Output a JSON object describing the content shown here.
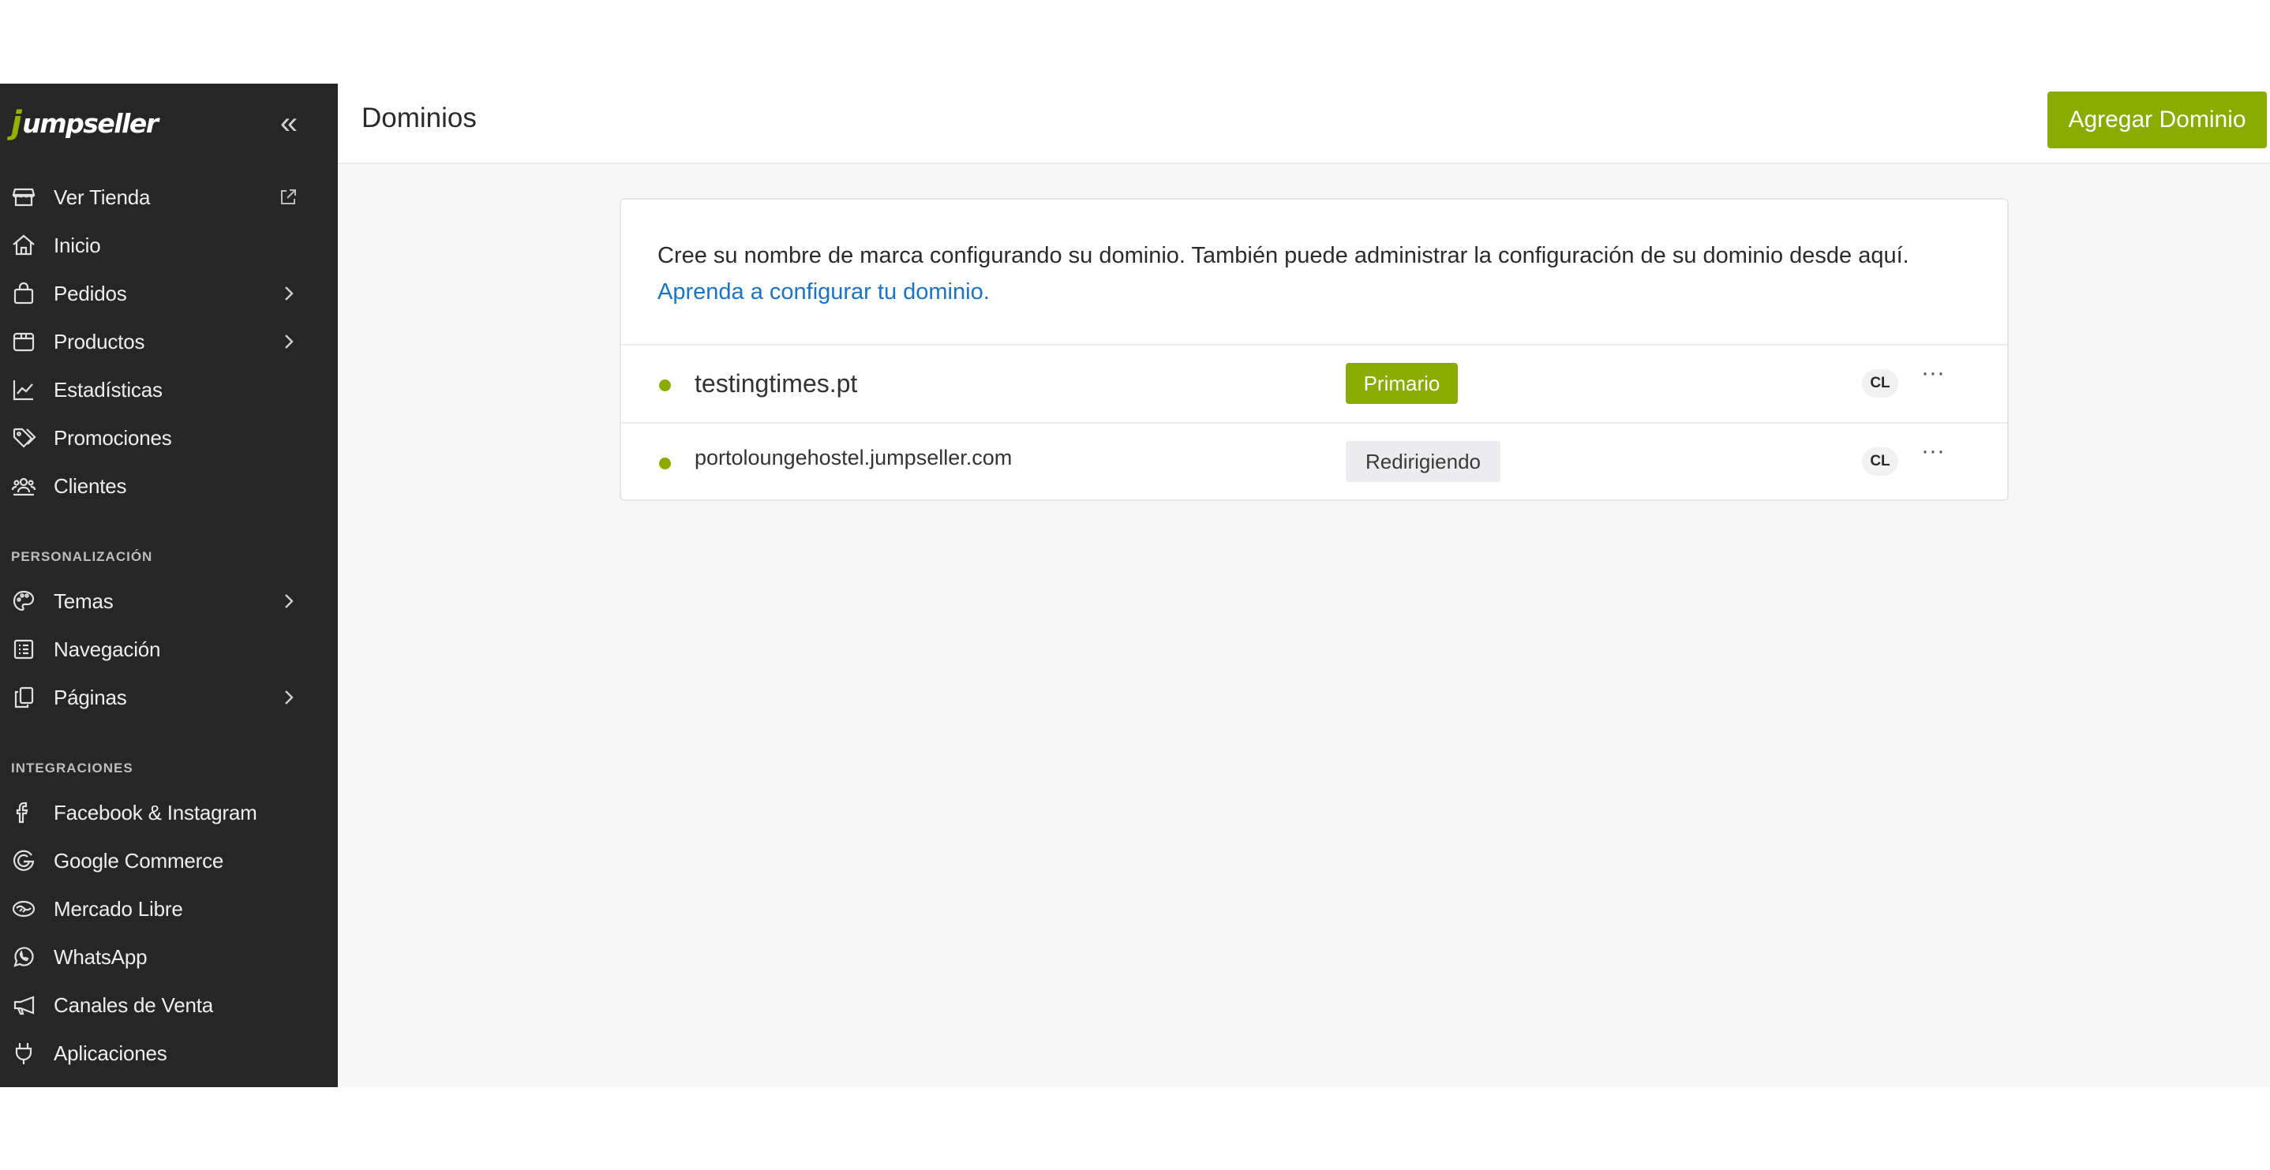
{
  "sidebar": {
    "logo_text": "umpseller",
    "logo_mark": "j",
    "collapse_icon": "«",
    "items": [
      {
        "label": "Ver Tienda",
        "icon": "store-icon"
      },
      {
        "label": "Inicio",
        "icon": "home-icon"
      },
      {
        "label": "Pedidos",
        "icon": "shopping-bag-icon"
      },
      {
        "label": "Productos",
        "icon": "box-icon"
      },
      {
        "label": "Estadísticas",
        "icon": "chart-line-icon"
      },
      {
        "label": "Promociones",
        "icon": "tag-icon"
      },
      {
        "label": "Clientes",
        "icon": "users-icon"
      }
    ],
    "personalization_title": "PERSONALIZACIÓN",
    "personalization_items": [
      {
        "label": "Temas",
        "icon": "palette-icon"
      },
      {
        "label": "Navegación",
        "icon": "list-icon"
      },
      {
        "label": "Páginas",
        "icon": "pages-icon"
      }
    ],
    "integrations_title": "INTEGRACIONES",
    "integrations_items": [
      {
        "label": "Facebook & Instagram",
        "icon": "facebook-icon"
      },
      {
        "label": "Google Commerce",
        "icon": "google-icon"
      },
      {
        "label": "Mercado Libre",
        "icon": "mercadolibre-icon"
      },
      {
        "label": "WhatsApp",
        "icon": "whatsapp-icon"
      },
      {
        "label": "Canales de Venta",
        "icon": "megaphone-icon"
      },
      {
        "label": "Aplicaciones",
        "icon": "plug-icon"
      }
    ]
  },
  "header": {
    "title": "Dominios",
    "add_button": "Agregar Dominio"
  },
  "card": {
    "intro": "Cree su nombre de marca configurando su dominio. También puede administrar la configuración de su dominio desde aquí.",
    "link": "Aprenda a configurar tu dominio.",
    "domains": [
      {
        "name": "testingtimes.pt",
        "status": "Primario",
        "country": "CL",
        "menu": "···"
      },
      {
        "name": "portoloungehostel.jumpseller.com",
        "status": "Redirigiendo",
        "country": "CL",
        "menu": "···"
      }
    ]
  },
  "colors": {
    "accent": "#8aab00",
    "sidebar_bg": "#262626",
    "link": "#1b74c3"
  }
}
